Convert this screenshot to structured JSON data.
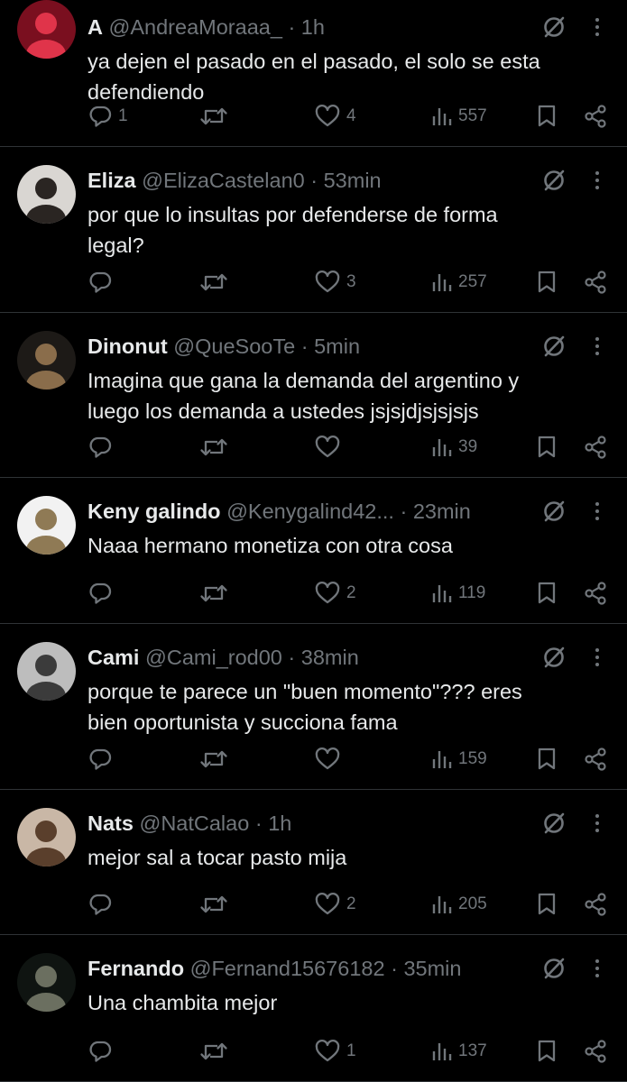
{
  "replies": [
    {
      "name": "A",
      "handle": "@AndreaMoraaa_",
      "sep": "·",
      "time": "1h",
      "text": "ya dejen el pasado en el pasado, el solo se esta\ndefendiendo",
      "replies": "1",
      "reposts": "",
      "likes": "4",
      "views": "557",
      "avatar_colors": [
        "#7a0f1f",
        "#e0344a"
      ]
    },
    {
      "name": "Eliza",
      "handle": "@ElizaCastelan0",
      "sep": "·",
      "time": "53min",
      "text": "por que lo insultas por defenderse de forma\nlegal?",
      "replies": "",
      "reposts": "",
      "likes": "3",
      "views": "257",
      "avatar_colors": [
        "#d9d6d2",
        "#2a2522"
      ]
    },
    {
      "name": "Dinonut",
      "handle": "@QueSooTe",
      "sep": "·",
      "time": "5min",
      "text": "Imagina que gana la demanda del argentino y\nluego los demanda a ustedes jsjsjdjsjsjsjs",
      "replies": "",
      "reposts": "",
      "likes": "",
      "views": "39",
      "avatar_colors": [
        "#1d1a17",
        "#8a6d4b"
      ]
    },
    {
      "name": "Keny galindo",
      "handle": "@Kenygalind42...",
      "sep": "·",
      "time": "23min",
      "text": "Naaa hermano monetiza con otra cosa",
      "replies": "",
      "reposts": "",
      "likes": "2",
      "views": "119",
      "avatar_colors": [
        "#f2f2f2",
        "#8f7a55"
      ]
    },
    {
      "name": "Cami",
      "handle": "@Cami_rod00",
      "sep": "·",
      "time": "38min",
      "text": "porque te parece un \"buen momento\"??? eres\nbien oportunista y succiona fama",
      "replies": "",
      "reposts": "",
      "likes": "",
      "views": "159",
      "avatar_colors": [
        "#bdbdbd",
        "#3b3b3b"
      ]
    },
    {
      "name": "Nats",
      "handle": "@NatCalao",
      "sep": "·",
      "time": "1h",
      "text": "mejor sal a tocar pasto mija",
      "replies": "",
      "reposts": "",
      "likes": "2",
      "views": "205",
      "avatar_colors": [
        "#c9b7a6",
        "#5a3f2c"
      ]
    },
    {
      "name": "Fernando",
      "handle": "@Fernand15676182",
      "sep": "·",
      "time": "35min",
      "text": "Una chambita mejor",
      "replies": "",
      "reposts": "",
      "likes": "1",
      "views": "137",
      "avatar_colors": [
        "#0f1411",
        "#6b6f60"
      ]
    }
  ],
  "icons": {
    "reply": "reply-icon",
    "repost": "repost-icon",
    "like": "heart-icon",
    "views": "views-icon",
    "bookmark": "bookmark-icon",
    "share": "share-icon",
    "grok": "grok-icon",
    "more": "more-icon"
  },
  "colors": {
    "background": "#000000",
    "text": "#e7e9ea",
    "muted": "#71767b",
    "divider": "#2f3336"
  }
}
